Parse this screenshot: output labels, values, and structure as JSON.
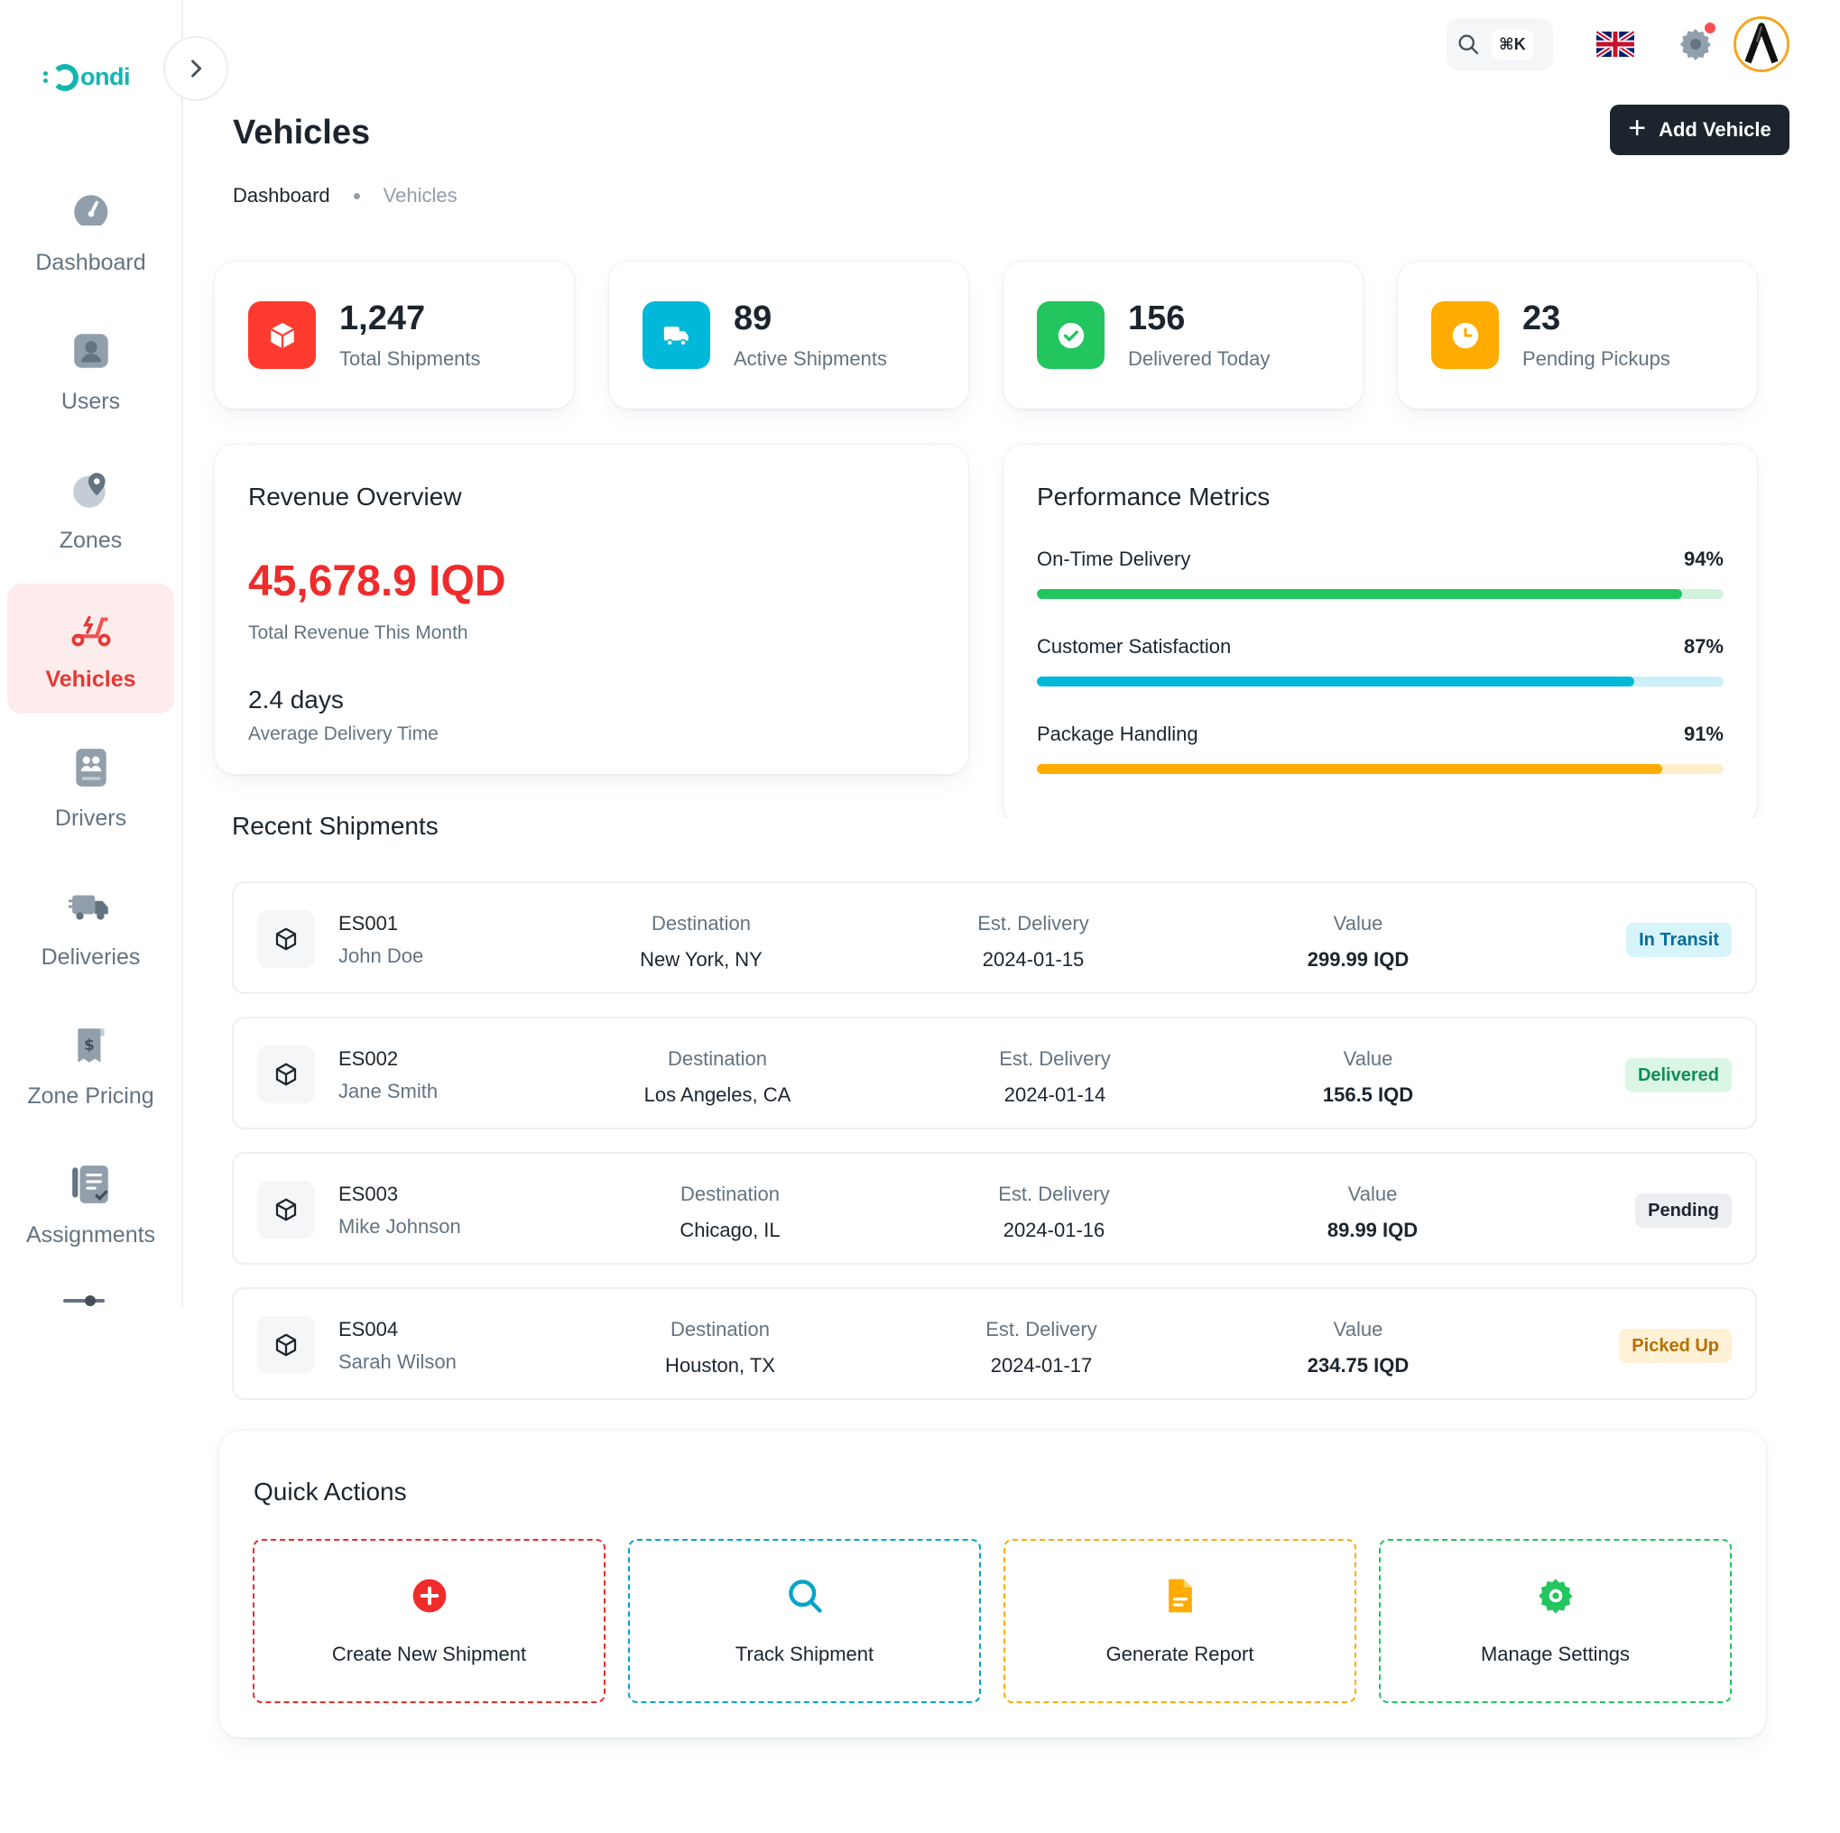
{
  "brand": {
    "name": "ondi",
    "color": "#13b5b1"
  },
  "sidebar": {
    "items": [
      {
        "label": "Dashboard",
        "icon": "dashboard-gauge-icon",
        "active": false
      },
      {
        "label": "Users",
        "icon": "user-icon",
        "active": false
      },
      {
        "label": "Zones",
        "icon": "map-pin-icon",
        "active": false
      },
      {
        "label": "Vehicles",
        "icon": "scooter-icon",
        "active": true
      },
      {
        "label": "Drivers",
        "icon": "drivers-icon",
        "active": false
      },
      {
        "label": "Deliveries",
        "icon": "truck-icon",
        "active": false
      },
      {
        "label": "Zone Pricing",
        "icon": "price-tag-icon",
        "active": false
      },
      {
        "label": "Assignments",
        "icon": "checklist-icon",
        "active": false
      }
    ]
  },
  "topbar": {
    "shortcut": "⌘K",
    "language_icon": "uk-flag-icon"
  },
  "header": {
    "title": "Vehicles",
    "breadcrumb": [
      "Dashboard",
      "Vehicles"
    ],
    "add_button": "Add Vehicle"
  },
  "stats": [
    {
      "value": "1,247",
      "label": "Total Shipments",
      "color": "#ff3b30",
      "icon": "package-icon"
    },
    {
      "value": "89",
      "label": "Active Shipments",
      "color": "#00b8d9",
      "icon": "truck-icon"
    },
    {
      "value": "156",
      "label": "Delivered Today",
      "color": "#22c55e",
      "icon": "check-circle-icon"
    },
    {
      "value": "23",
      "label": "Pending Pickups",
      "color": "#ffab00",
      "icon": "clock-icon"
    }
  ],
  "revenue": {
    "title": "Revenue Overview",
    "amount": "45,678.9 IQD",
    "amount_label": "Total Revenue This Month",
    "avg_time": "2.4 days",
    "avg_time_label": "Average Delivery Time"
  },
  "performance": {
    "title": "Performance Metrics",
    "metrics": [
      {
        "label": "On-Time Delivery",
        "pct_text": "94%",
        "value": 0.94,
        "color": "#22c55e",
        "track": "#d3f2dd"
      },
      {
        "label": "Customer Satisfaction",
        "pct_text": "87%",
        "value": 0.87,
        "color": "#00b8d9",
        "track": "#ccf0f7"
      },
      {
        "label": "Package Handling",
        "pct_text": "91%",
        "value": 0.91,
        "color": "#ffab00",
        "track": "#ffeecc"
      }
    ]
  },
  "recent": {
    "title": "Recent Shipments",
    "dest_label": "Destination",
    "eta_label": "Est. Delivery",
    "value_label": "Value",
    "rows": [
      {
        "id": "ES001",
        "name": "John Doe",
        "destination": "New York, NY",
        "eta": "2024-01-15",
        "value": "299.99 IQD",
        "status": "In Transit",
        "status_color": "#006c9c",
        "status_bg": "#d6f4f9"
      },
      {
        "id": "ES002",
        "name": "Jane Smith",
        "destination": "Los Angeles, CA",
        "eta": "2024-01-14",
        "value": "156.5 IQD",
        "status": "Delivered",
        "status_color": "#118d57",
        "status_bg": "#dbf6e5"
      },
      {
        "id": "ES003",
        "name": "Mike Johnson",
        "destination": "Chicago, IL",
        "eta": "2024-01-16",
        "value": "89.99 IQD",
        "status": "Pending",
        "status_color": "#1c252e",
        "status_bg": "#eceef1"
      },
      {
        "id": "ES004",
        "name": "Sarah Wilson",
        "destination": "Houston, TX",
        "eta": "2024-01-17",
        "value": "234.75 IQD",
        "status": "Picked Up",
        "status_color": "#b76e00",
        "status_bg": "#fff1d6"
      }
    ]
  },
  "quick_actions": {
    "title": "Quick Actions",
    "items": [
      {
        "label": "Create New Shipment",
        "icon": "plus-circle-icon",
        "color": "#ef2b2b"
      },
      {
        "label": "Track Shipment",
        "icon": "search-icon",
        "color": "#00a5c7"
      },
      {
        "label": "Generate Report",
        "icon": "document-icon",
        "color": "#ffab00"
      },
      {
        "label": "Manage Settings",
        "icon": "gear-icon",
        "color": "#22c55e"
      }
    ]
  }
}
